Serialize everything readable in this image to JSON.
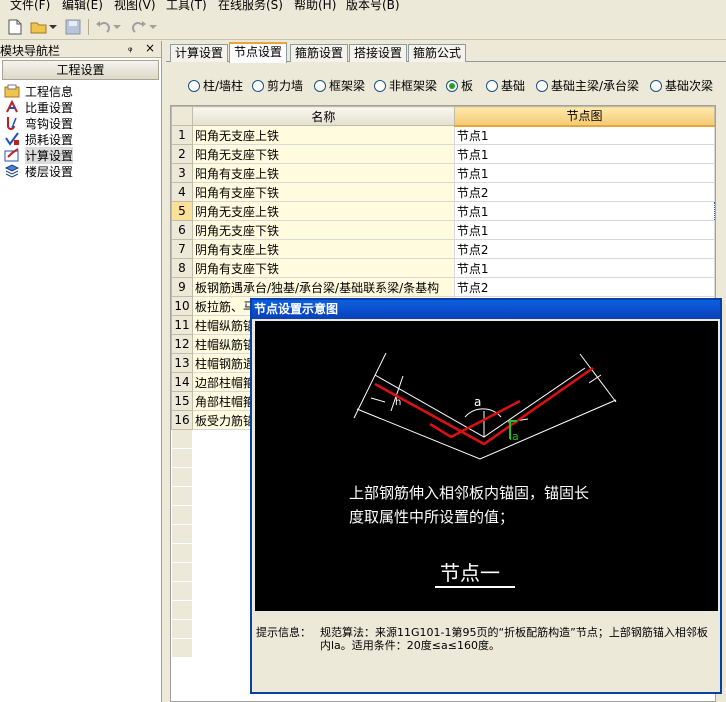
{
  "menubar": [
    "文件(F)",
    "编辑(E)",
    "视图(V)",
    "工具(T)",
    "在线服务(S)",
    "帮助(H)",
    "版本号(B)"
  ],
  "nav": {
    "title": "模块导航栏",
    "pin": "ᵩ",
    "close": "×",
    "group": "工程设置",
    "items": [
      "工程信息",
      "比重设置",
      "弯钩设置",
      "损耗设置",
      "计算设置",
      "楼层设置"
    ],
    "selected_index": 4
  },
  "tabs": [
    "计算设置",
    "节点设置",
    "箍筋设置",
    "搭接设置",
    "箍筋公式"
  ],
  "active_tab_index": 1,
  "radios": [
    "柱/墙柱",
    "剪力墙",
    "框架梁",
    "非框架梁",
    "板",
    "基础",
    "基础主梁/承台梁",
    "基础次梁"
  ],
  "selected_radio_index": 4,
  "grid": {
    "columns": [
      "名称",
      "节点图"
    ],
    "rows": [
      {
        "num": "1",
        "name": "阳角无支座上铁",
        "value": "节点1"
      },
      {
        "num": "2",
        "name": "阳角无支座下铁",
        "value": "节点1"
      },
      {
        "num": "3",
        "name": "阳角有支座上铁",
        "value": "节点1"
      },
      {
        "num": "4",
        "name": "阳角有支座下铁",
        "value": "节点2"
      },
      {
        "num": "5",
        "name": "阴角无支座上铁",
        "value": "节点1"
      },
      {
        "num": "6",
        "name": "阴角无支座下铁",
        "value": "节点1"
      },
      {
        "num": "7",
        "name": "阴角有支座上铁",
        "value": "节点2"
      },
      {
        "num": "8",
        "name": "阴角有支座下铁",
        "value": "节点1"
      },
      {
        "num": "9",
        "name": "板钢筋遇承台/独基/承台梁/基础联系梁/条基构",
        "value": "节点2"
      },
      {
        "num": "10",
        "name": "板拉筋、马",
        "value": ""
      },
      {
        "num": "11",
        "name": "柱帽纵筋锚",
        "value": ""
      },
      {
        "num": "12",
        "name": "柱帽纵筋锚",
        "value": ""
      },
      {
        "num": "13",
        "name": "柱帽钢筋遇",
        "value": ""
      },
      {
        "num": "14",
        "name": "边部柱帽箍",
        "value": ""
      },
      {
        "num": "15",
        "name": "角部柱帽箍",
        "value": ""
      },
      {
        "num": "16",
        "name": "板受力筋锚",
        "value": ""
      }
    ],
    "selected_row_index": 4
  },
  "popup": {
    "title": "节点设置示意图",
    "diagram_label_a": "a",
    "diagram_label_la": "la",
    "diagram_label_h": "h",
    "line1": "上部钢筋伸入相邻板内锚固，锚固长",
    "line2": "度取属性中所设置的值；",
    "caption": "节点一",
    "info_label": "提示信息：",
    "info_text": "规范算法：来源11G101-1第95页的“折板配筋构造”节点；上部钢筋锚入相邻板内la。适用条件：20度≤a≤160度。"
  },
  "colors": {
    "rebar": "#e01010",
    "anchor": "#20c020",
    "title_bar": "#0a40b8",
    "active_tab_top": "#e8a53a"
  }
}
